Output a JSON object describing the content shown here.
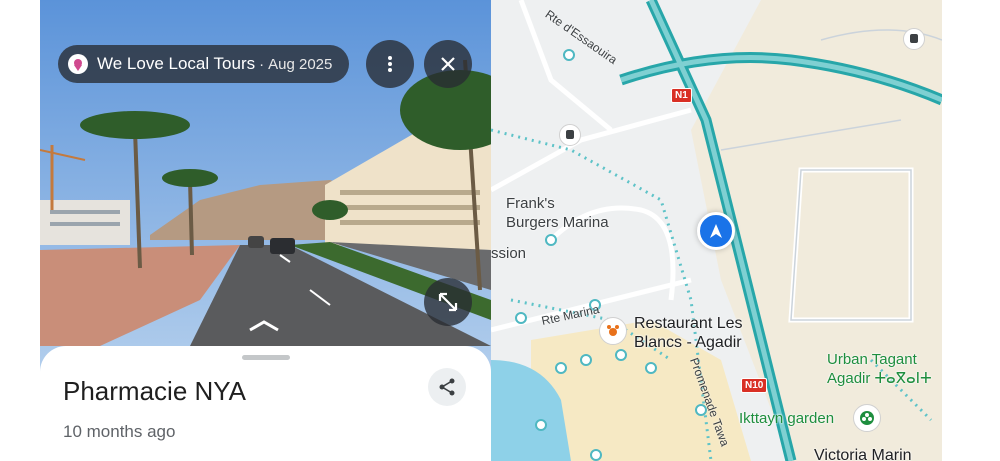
{
  "street_view": {
    "contributor": "We Love Local Tours",
    "separator": "·",
    "date": "Aug 2025"
  },
  "place": {
    "name": "Pharmacie NYA",
    "age": "10 months ago"
  },
  "map": {
    "roads": {
      "rte_essaouira": "Rte d'Essaouira",
      "rte_marina": "Rte Marina",
      "promenade": "Promenade Tawa"
    },
    "shields": {
      "n1": "N1",
      "n10": "N10"
    },
    "labels": {
      "franks": "Frank's\nBurgers Marina",
      "mission": "ssion",
      "restaurant": "Restaurant Les\nBlancs - Agadir",
      "urban_tagant": "Urban Tagant\nAgadir ⵜⴰⴳⴰⵏⵜ",
      "ikttayn": "Ikttayn garden",
      "victoria": "Victoria Marin"
    }
  }
}
